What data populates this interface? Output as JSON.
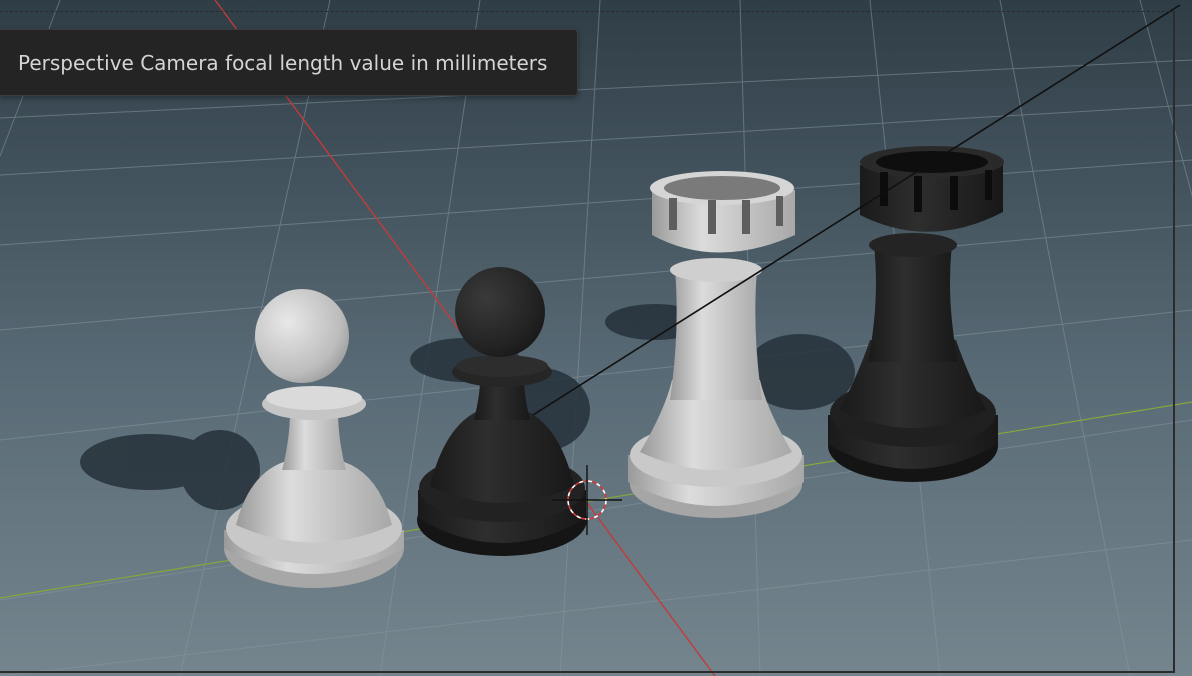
{
  "tooltip": {
    "text": "Perspective Camera focal length value in millimeters"
  },
  "scene": {
    "objects": [
      {
        "name": "white-pawn",
        "color": "#c8c8c8"
      },
      {
        "name": "black-pawn",
        "color": "#262626"
      },
      {
        "name": "white-rook",
        "color": "#cfcfcf"
      },
      {
        "name": "black-rook",
        "color": "#232323"
      }
    ],
    "colors": {
      "background_top": "#2f3d46",
      "background_bottom": "#6e7f89",
      "grid": "#7f8f99",
      "x_axis": "#c23b3b",
      "y_axis": "#86a83a"
    }
  }
}
